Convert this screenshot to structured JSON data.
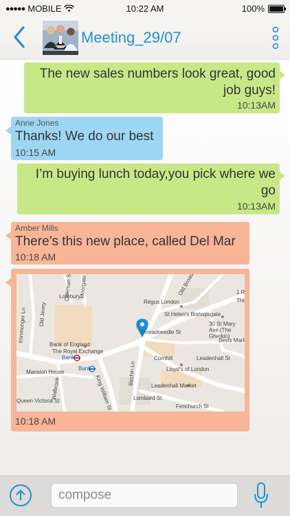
{
  "status_bar": {
    "carrier": "MOBILE",
    "time": "10:22 AM",
    "battery": "100%"
  },
  "header": {
    "title": "Meeting_29/07",
    "back_icon": "chevron-left-icon",
    "more_icon": "vertical-dots-icon"
  },
  "messages": [
    {
      "direction": "outgoing",
      "text": "The new sales numbers look great, good job guys!",
      "time": "10:13AM"
    },
    {
      "direction": "incoming",
      "sender": "Anne Jones",
      "text": "Thanks! We do our best",
      "time": "10:15 AM"
    },
    {
      "direction": "outgoing",
      "text": "I’m buying lunch today,you pick where we go",
      "time": "10:13AM"
    },
    {
      "direction": "incoming",
      "sender": "Amber Mills",
      "text": "There’s this new place, called Del Mar",
      "time": "10:18 AM"
    },
    {
      "direction": "incoming",
      "type": "location",
      "time": "10:18 AM"
    }
  ],
  "map": {
    "labels": [
      "Lothbury",
      "Bank of England",
      "The Royal Exchange",
      "Bank",
      "Bank",
      "Mansion House",
      "Regus London",
      "St Helen's Bishopsgate",
      "30 St Mary Axe (The Gherkin)",
      "Bevis Marks",
      "Threadneedle St",
      "Cornhill",
      "Leadenhall St",
      "Lloyd's of London",
      "Leadenhall Market",
      "Lombard St",
      "Fenchurch St",
      "Old Broad St",
      "Coleman St",
      "Moorgate",
      "Old Jewry",
      "Ironmonger Ln",
      "Walbrook",
      "King William St",
      "Birchin Ln",
      "Queen Victoria St",
      "1 Ri",
      "The"
    ]
  },
  "compose": {
    "placeholder": "compose",
    "send_icon": "arrow-up-icon",
    "mic_icon": "microphone-icon"
  },
  "colors": {
    "accent": "#1e8fd6",
    "outgoing_bubble": "#c8e888",
    "incoming_blue": "#9dd6f2",
    "incoming_orange": "#f8b598"
  }
}
